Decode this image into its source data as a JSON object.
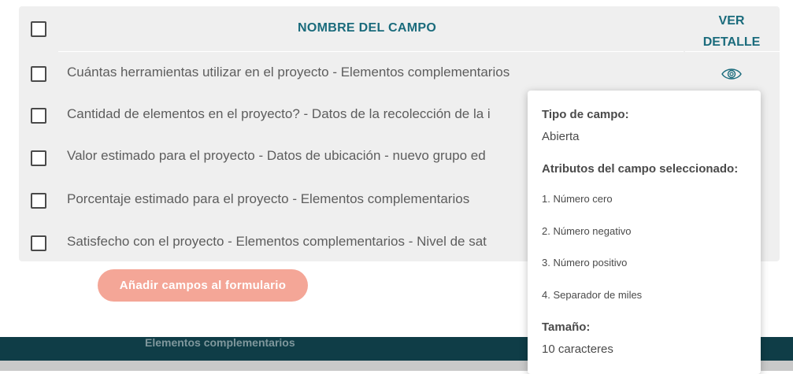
{
  "table": {
    "header": {
      "field_name": "NOMBRE DEL CAMPO",
      "detail_line1": "VER",
      "detail_line2": "DETALLE"
    },
    "rows": [
      {
        "label": "Cuántas herramientas utilizar en el proyecto - Elementos complementarios"
      },
      {
        "label": "Cantidad de elementos en el proyecto? - Datos de la recolección de la i"
      },
      {
        "label": "Valor estimado para el proyecto - Datos de ubicación - nuevo grupo ed"
      },
      {
        "label": "Porcentaje estimado para el proyecto - Elementos complementarios"
      },
      {
        "label": "Satisfecho con el proyecto - Elementos complementarios - Nivel de sat"
      }
    ]
  },
  "add_button": {
    "label": "Añadir campos al formulario"
  },
  "background_text": "Elementos complementarios",
  "popover": {
    "type_label": "Tipo de campo:",
    "type_value": "Abierta",
    "attributes_label": "Atributos del campo seleccionado:",
    "attributes": [
      "1. Número cero",
      "2. Número negativo",
      "3. Número positivo",
      "4. Separador de miles"
    ],
    "size_label": "Tamaño:",
    "size_value": "10 caracteres"
  },
  "colors": {
    "accent": "#1a6b7c",
    "button": "#f4a697",
    "dark_band": "#0f3d47"
  },
  "icons": {
    "detail": "eye-icon"
  }
}
